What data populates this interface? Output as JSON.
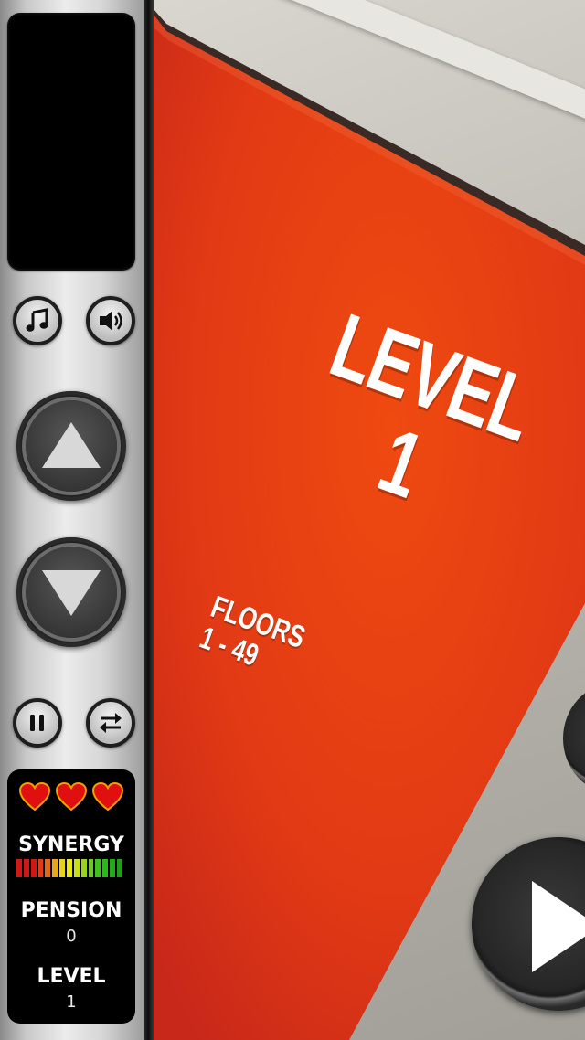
{
  "level_card": {
    "title": "LEVEL",
    "level_number": "1",
    "floors_label": "FLOORS",
    "floors_range": "1 - 49"
  },
  "controls": {
    "music_icon": "music-note-icon",
    "sound_icon": "speaker-icon",
    "up_icon": "up-arrow-icon",
    "down_icon": "down-arrow-icon",
    "pause_icon": "pause-icon",
    "swap_icon": "swap-arrows-icon",
    "play_icon": "play-icon"
  },
  "stats": {
    "lives": 3,
    "synergy_label": "SYNERGY",
    "synergy_colors": [
      "#d01818",
      "#d01818",
      "#d01818",
      "#e03a18",
      "#e06a18",
      "#e8a81a",
      "#e8d21a",
      "#e8e81a",
      "#c8e01a",
      "#9ad41a",
      "#6acb1a",
      "#3fc21a",
      "#2eb81a",
      "#22aa18",
      "#1f9e18"
    ],
    "pension_label": "PENSION",
    "pension_value": "0",
    "level_label": "LEVEL",
    "level_value": "1"
  },
  "colors": {
    "card_red": "#e8421b",
    "heart_red": "#e01010"
  }
}
